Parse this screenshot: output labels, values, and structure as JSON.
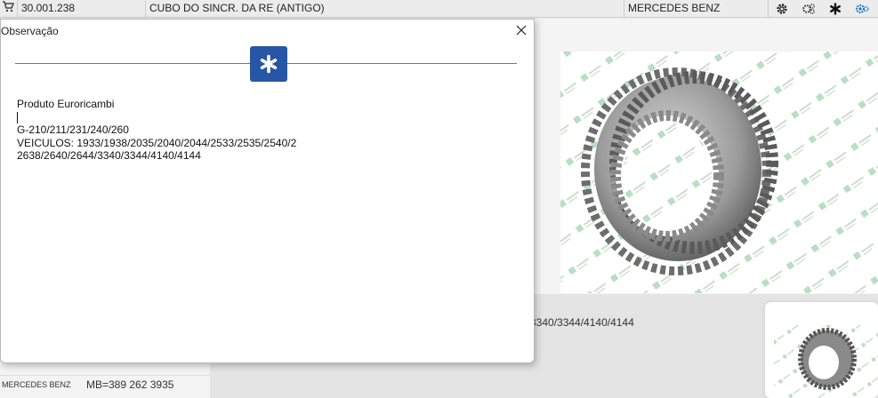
{
  "top_row": {
    "code": "30.001.238",
    "description": "CUBO DO SINCR. DA RE (ANTIGO)",
    "brand": "MERCEDES BENZ",
    "icons": [
      "cart-icon",
      "gear-icon",
      "gear-settings-icon",
      "asterisk-icon",
      "gears-icon"
    ]
  },
  "background": {
    "panel_text": "3340/3344/4140/4144",
    "left_table": [
      {
        "brand": "MERCEDES BENZ",
        "code": "MB=389 262 3935"
      }
    ]
  },
  "dialog": {
    "title": "Observação",
    "close_icon": "close-icon",
    "badge_icon": "asterisk-icon",
    "body": {
      "line1": "Produto Euroricambi",
      "line3": "G-210/211/231/240/260",
      "line4": "VEICULOS: 1933/1938/2035/2040/2044/2533/2535/2540/2",
      "line5": "2638/2640/2644/3340/3344/4140/4144"
    }
  },
  "colors": {
    "accent_blue": "#2756a6",
    "teal_line": "#3a8f93",
    "gear_icon_blue": "#1a73c7"
  }
}
